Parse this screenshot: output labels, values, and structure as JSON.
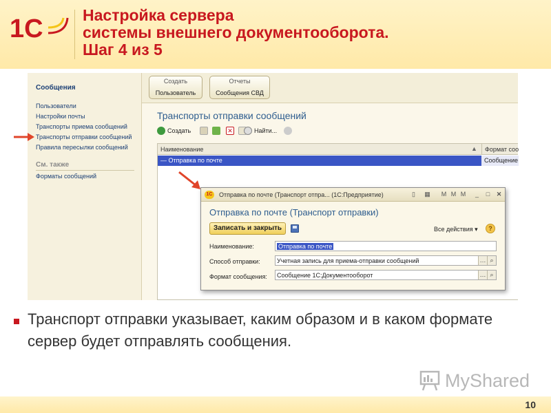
{
  "slide": {
    "title_line1": "Настройка сервера",
    "title_line2": "системы внешнего документооборота.",
    "title_line3": "Шаг 4 из 5",
    "bullet_text": "Транспорт отправки указывает, каким образом и в каком формате сервер будет отправлять сообщения.",
    "page_number": "10",
    "logo_text": "1С",
    "watermark_text": "MyShared"
  },
  "nav": {
    "title": "Сообщения",
    "items": [
      {
        "label": "Пользователи"
      },
      {
        "label": "Настройки почты"
      },
      {
        "label": "Транспорты приема сообщений"
      },
      {
        "label": "Транспорты отправки сообщений"
      },
      {
        "label": "Правила пересылки сообщений"
      }
    ],
    "see_also_title": "См. также",
    "see_also_items": [
      {
        "label": "Форматы сообщений"
      }
    ]
  },
  "topbar": {
    "groups": [
      {
        "caption": "Создать",
        "button": "Пользователь"
      },
      {
        "caption": "Отчеты",
        "button": "Сообщения СВД"
      }
    ]
  },
  "list_form": {
    "title": "Транспорты отправки сообщений",
    "toolbar": {
      "create_label": "Создать",
      "find_label": "Найти..."
    },
    "columns": [
      "Наименование",
      "Формат сообщения"
    ],
    "rows": [
      {
        "name": "Отправка по почте",
        "format": "Сообщение"
      }
    ]
  },
  "dialog": {
    "window_title": "Отправка по почте (Транспорт отпра... (1С:Предприятие)",
    "heading": "Отправка по почте (Транспорт отправки)",
    "save_close_label": "Записать и закрыть",
    "all_actions_label": "Все действия ▾",
    "help_label": "?",
    "fields": {
      "name_label": "Наименование:",
      "name_value": "Отправка по почте",
      "method_label": "Способ отправки:",
      "method_value": "Учетная запись для приема-отправки сообщений",
      "format_label": "Формат сообщения:",
      "format_value": "Сообщение 1С:Документооборот"
    }
  },
  "colors": {
    "accent_red": "#c8181f",
    "link_blue": "#2d5c8e",
    "selection_blue": "#3a55c5",
    "header_yellow": "#ffe9a8"
  }
}
